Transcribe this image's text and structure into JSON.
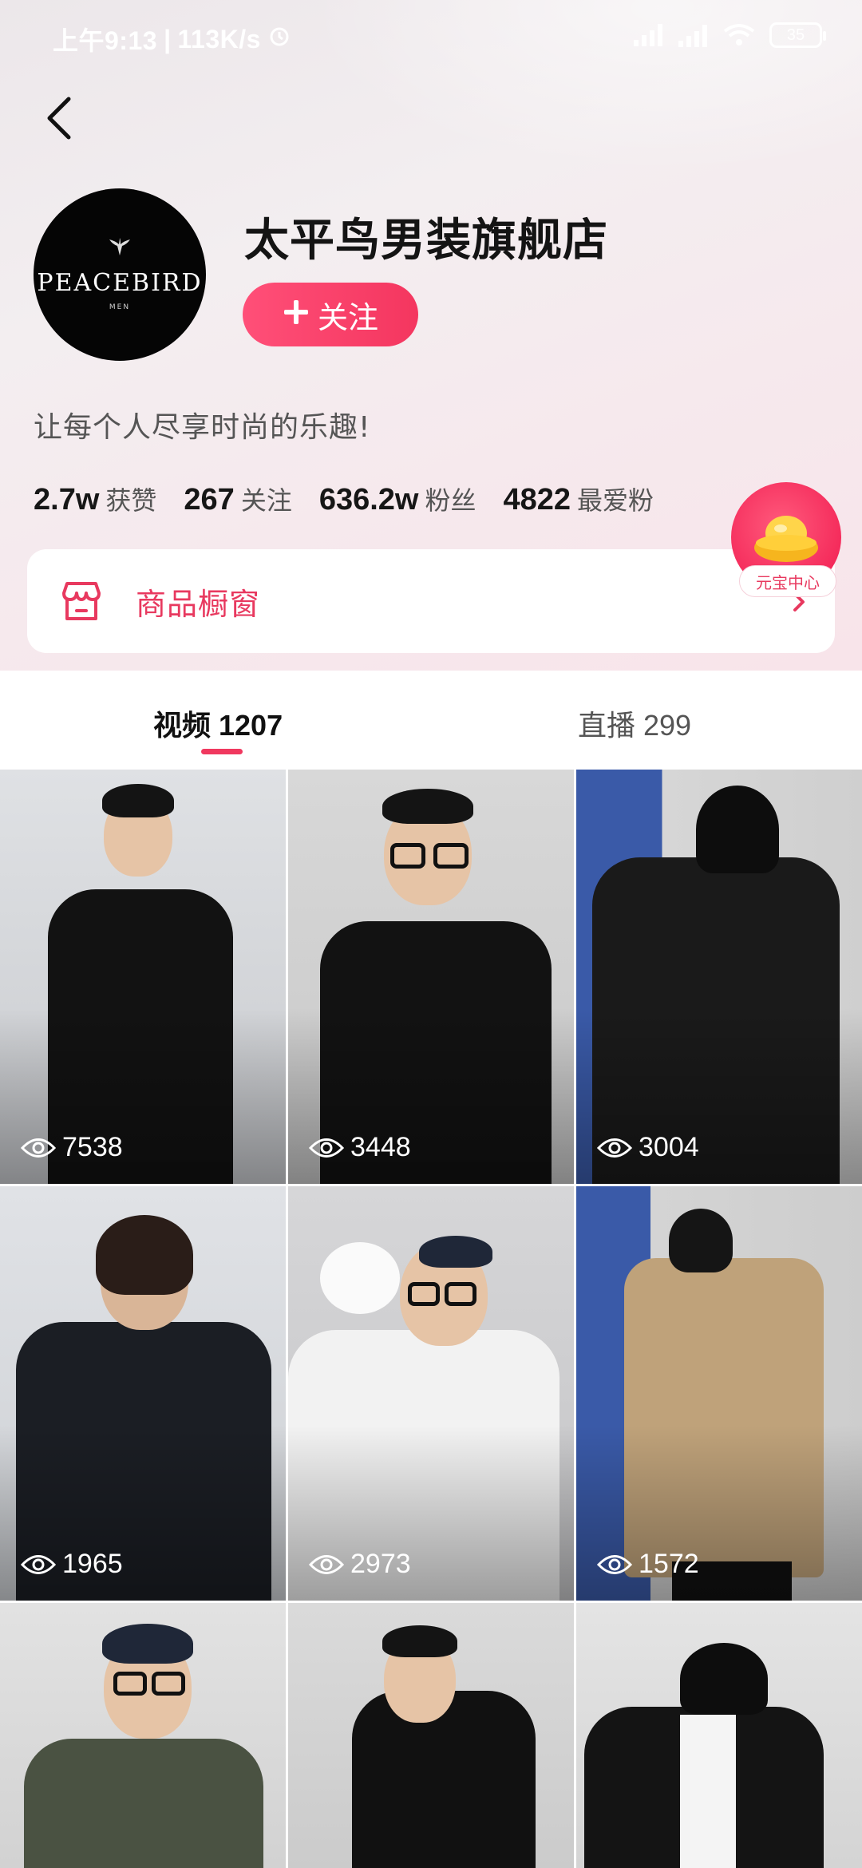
{
  "status_bar": {
    "time": "上午9:13",
    "speed": "113K/s",
    "battery": "35"
  },
  "shop": {
    "name": "太平鸟男装旗舰店",
    "avatar_brand": "PEACEBIRD",
    "avatar_sub": "MEN",
    "follow_label": "关注",
    "slogan": "让每个人尽享时尚的乐趣!"
  },
  "stats": [
    {
      "num": "2.7w",
      "label": "获赞"
    },
    {
      "num": "267",
      "label": "关注"
    },
    {
      "num": "636.2w",
      "label": "粉丝"
    },
    {
      "num": "4822",
      "label": "最爱粉"
    }
  ],
  "showcase": {
    "label": "商品橱窗"
  },
  "yuanbao": {
    "label": "元宝中心"
  },
  "tabs": {
    "videos": {
      "label": "视频",
      "count": "1207"
    },
    "live": {
      "label": "直播",
      "count": "299"
    }
  },
  "videos": [
    {
      "views": "7538"
    },
    {
      "views": "3448"
    },
    {
      "views": "3004"
    },
    {
      "views": "1965"
    },
    {
      "views": "2973"
    },
    {
      "views": "1572"
    },
    {
      "views": ""
    },
    {
      "views": ""
    },
    {
      "views": ""
    }
  ],
  "colors": {
    "accent": "#f0385f",
    "text_primary": "#141414",
    "text_secondary": "#555555"
  },
  "icons": {
    "back": "chevron-left-icon",
    "store": "store-icon",
    "eye": "eye-icon",
    "plus": "plus-icon"
  }
}
